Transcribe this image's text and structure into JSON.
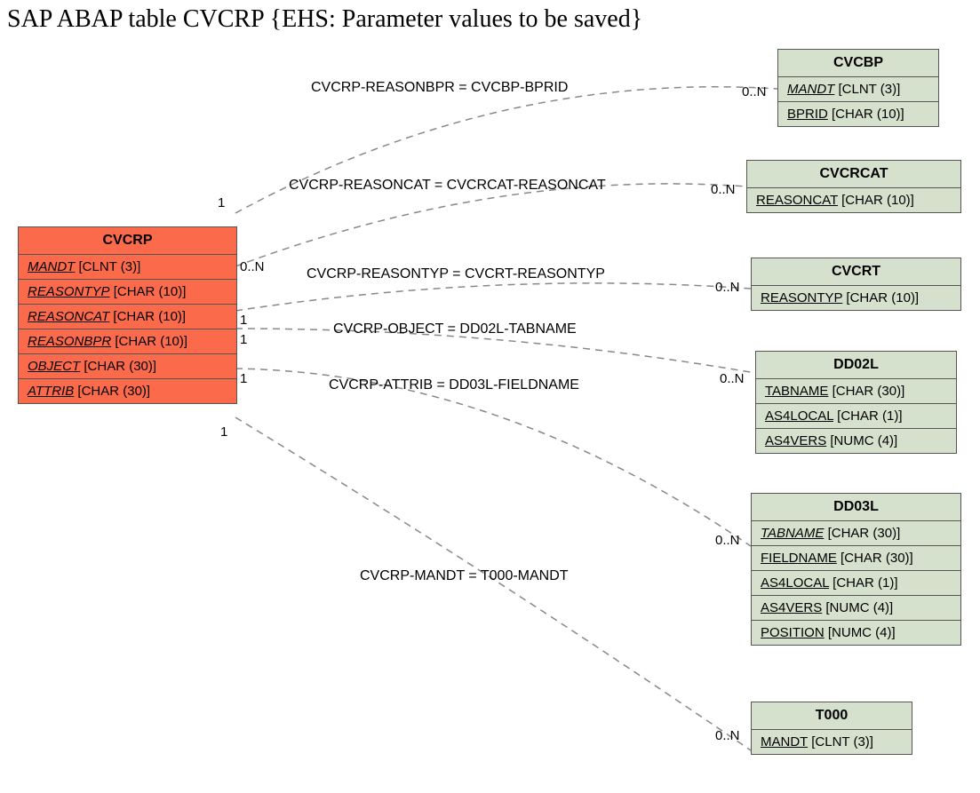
{
  "title": "SAP ABAP table CVCRP {EHS: Parameter values to be saved}",
  "tables": {
    "cvcrp": {
      "name": "CVCRP",
      "fields": [
        {
          "name": "MANDT",
          "type": "[CLNT (3)]",
          "fk": true
        },
        {
          "name": "REASONTYP",
          "type": "[CHAR (10)]",
          "fk": true
        },
        {
          "name": "REASONCAT",
          "type": "[CHAR (10)]",
          "fk": true
        },
        {
          "name": "REASONBPR",
          "type": "[CHAR (10)]",
          "fk": true
        },
        {
          "name": "OBJECT",
          "type": "[CHAR (30)]",
          "fk": true
        },
        {
          "name": "ATTRIB",
          "type": "[CHAR (30)]",
          "fk": true
        }
      ]
    },
    "cvcbp": {
      "name": "CVCBP",
      "fields": [
        {
          "name": "MANDT",
          "type": "[CLNT (3)]",
          "fk": true
        },
        {
          "name": "BPRID",
          "type": "[CHAR (10)]",
          "fk": false
        }
      ]
    },
    "cvcrcat": {
      "name": "CVCRCAT",
      "fields": [
        {
          "name": "REASONCAT",
          "type": "[CHAR (10)]",
          "fk": false
        }
      ]
    },
    "cvcrt": {
      "name": "CVCRT",
      "fields": [
        {
          "name": "REASONTYP",
          "type": "[CHAR (10)]",
          "fk": false
        }
      ]
    },
    "dd02l": {
      "name": "DD02L",
      "fields": [
        {
          "name": "TABNAME",
          "type": "[CHAR (30)]",
          "fk": false
        },
        {
          "name": "AS4LOCAL",
          "type": "[CHAR (1)]",
          "fk": false
        },
        {
          "name": "AS4VERS",
          "type": "[NUMC (4)]",
          "fk": false
        }
      ]
    },
    "dd03l": {
      "name": "DD03L",
      "fields": [
        {
          "name": "TABNAME",
          "type": "[CHAR (30)]",
          "fk": true
        },
        {
          "name": "FIELDNAME",
          "type": "[CHAR (30)]",
          "fk": false
        },
        {
          "name": "AS4LOCAL",
          "type": "[CHAR (1)]",
          "fk": false
        },
        {
          "name": "AS4VERS",
          "type": "[NUMC (4)]",
          "fk": false
        },
        {
          "name": "POSITION",
          "type": "[NUMC (4)]",
          "fk": false
        }
      ]
    },
    "t000": {
      "name": "T000",
      "fields": [
        {
          "name": "MANDT",
          "type": "[CLNT (3)]",
          "fk": false
        }
      ]
    }
  },
  "relations": [
    {
      "label": "CVCRP-REASONBPR = CVCBP-BPRID",
      "left_card": "1",
      "right_card": "0..N"
    },
    {
      "label": "CVCRP-REASONCAT = CVCRCAT-REASONCAT",
      "left_card": "0..N",
      "right_card": "0..N"
    },
    {
      "label": "CVCRP-REASONTYP = CVCRT-REASONTYP",
      "left_card": "1",
      "right_card": "0..N"
    },
    {
      "label": "CVCRP-OBJECT = DD02L-TABNAME",
      "left_card": "1",
      "right_card": "0..N"
    },
    {
      "label": "CVCRP-ATTRIB = DD03L-FIELDNAME",
      "left_card": "1",
      "right_card": "0..N"
    },
    {
      "label": "CVCRP-MANDT = T000-MANDT",
      "left_card": "1",
      "right_card": "0..N"
    }
  ]
}
